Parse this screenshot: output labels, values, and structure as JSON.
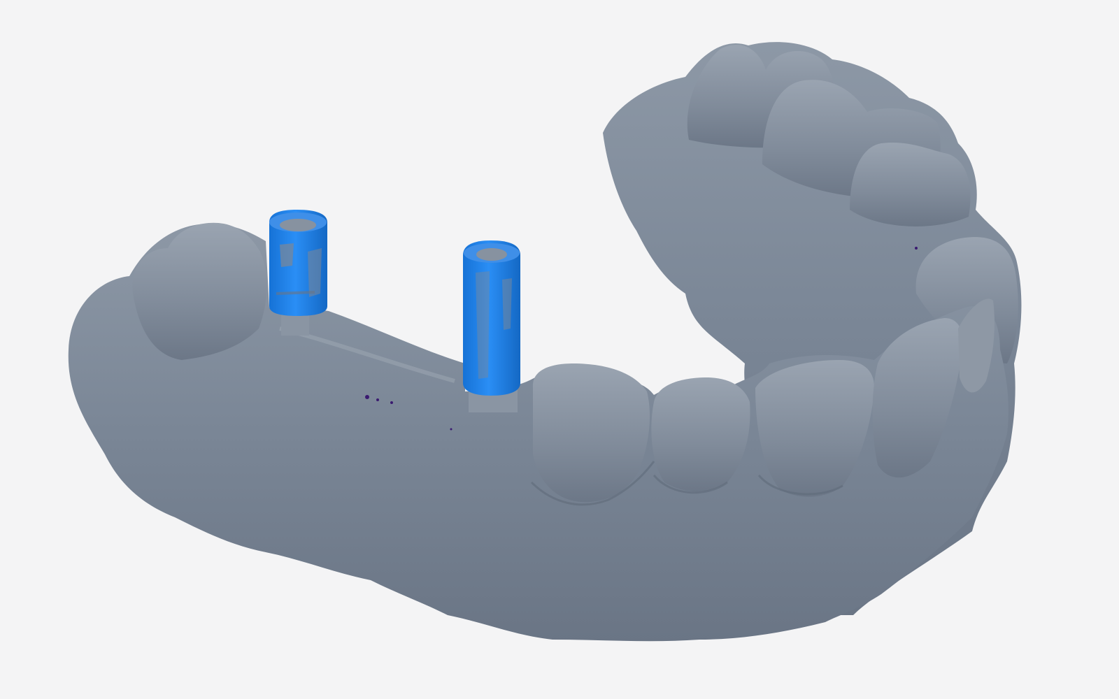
{
  "viewport": {
    "background_color": "#f4f4f5"
  },
  "model": {
    "description_icon": "dental-scan-mesh",
    "mesh_color": "#7b8797",
    "mesh_highlight_color": "#a7b0bc",
    "mesh_shadow_color": "#596473",
    "scanbody_color": "#1e88f0",
    "artifact_color": "#3a1a70"
  }
}
